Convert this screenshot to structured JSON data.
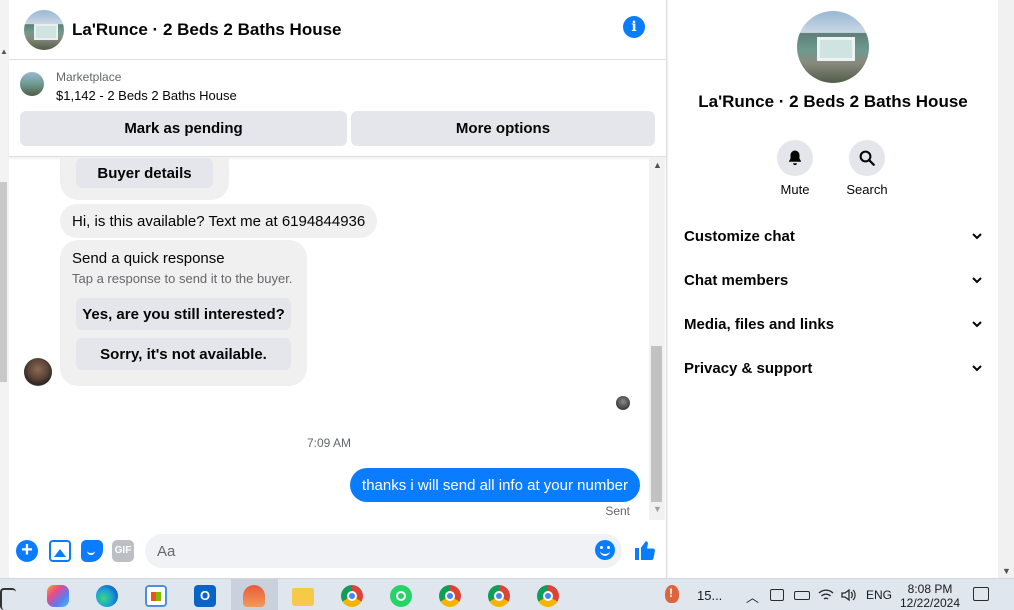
{
  "chat": {
    "title": "La'Runce · 2 Beds 2 Baths House",
    "marketplace": {
      "label": "Marketplace",
      "listing": "$1,142 - 2 Beds 2 Baths House",
      "mark_pending": "Mark as pending",
      "more_options": "More options"
    },
    "messages": {
      "buyer_details": "Buyer details",
      "incoming_text": "Hi, is this available? Text me at 6194844936",
      "quick_response_title": "Send a quick response",
      "quick_response_subtitle": "Tap a response to send it to the buyer.",
      "quick_reply_1": "Yes, are you still interested?",
      "quick_reply_2": "Sorry, it's not available.",
      "timestamp": "7:09 AM",
      "outgoing_text": "thanks i will send all info at your number",
      "status": "Sent"
    },
    "composer": {
      "placeholder": "Aa",
      "gif_label": "GIF"
    }
  },
  "panel": {
    "title": "La'Runce · 2 Beds 2 Baths House",
    "actions": {
      "mute": "Mute",
      "search": "Search"
    },
    "sections": [
      "Customize chat",
      "Chat members",
      "Media, files and links",
      "Privacy & support"
    ]
  },
  "taskbar": {
    "weather": "15...",
    "language": "ENG",
    "time": "8:08 PM",
    "date": "12/22/2024",
    "outlook_letter": "O"
  },
  "colors": {
    "accent": "#0a7cff",
    "bubble_gray": "#f0f0f0",
    "button_gray": "#e4e6eb"
  }
}
